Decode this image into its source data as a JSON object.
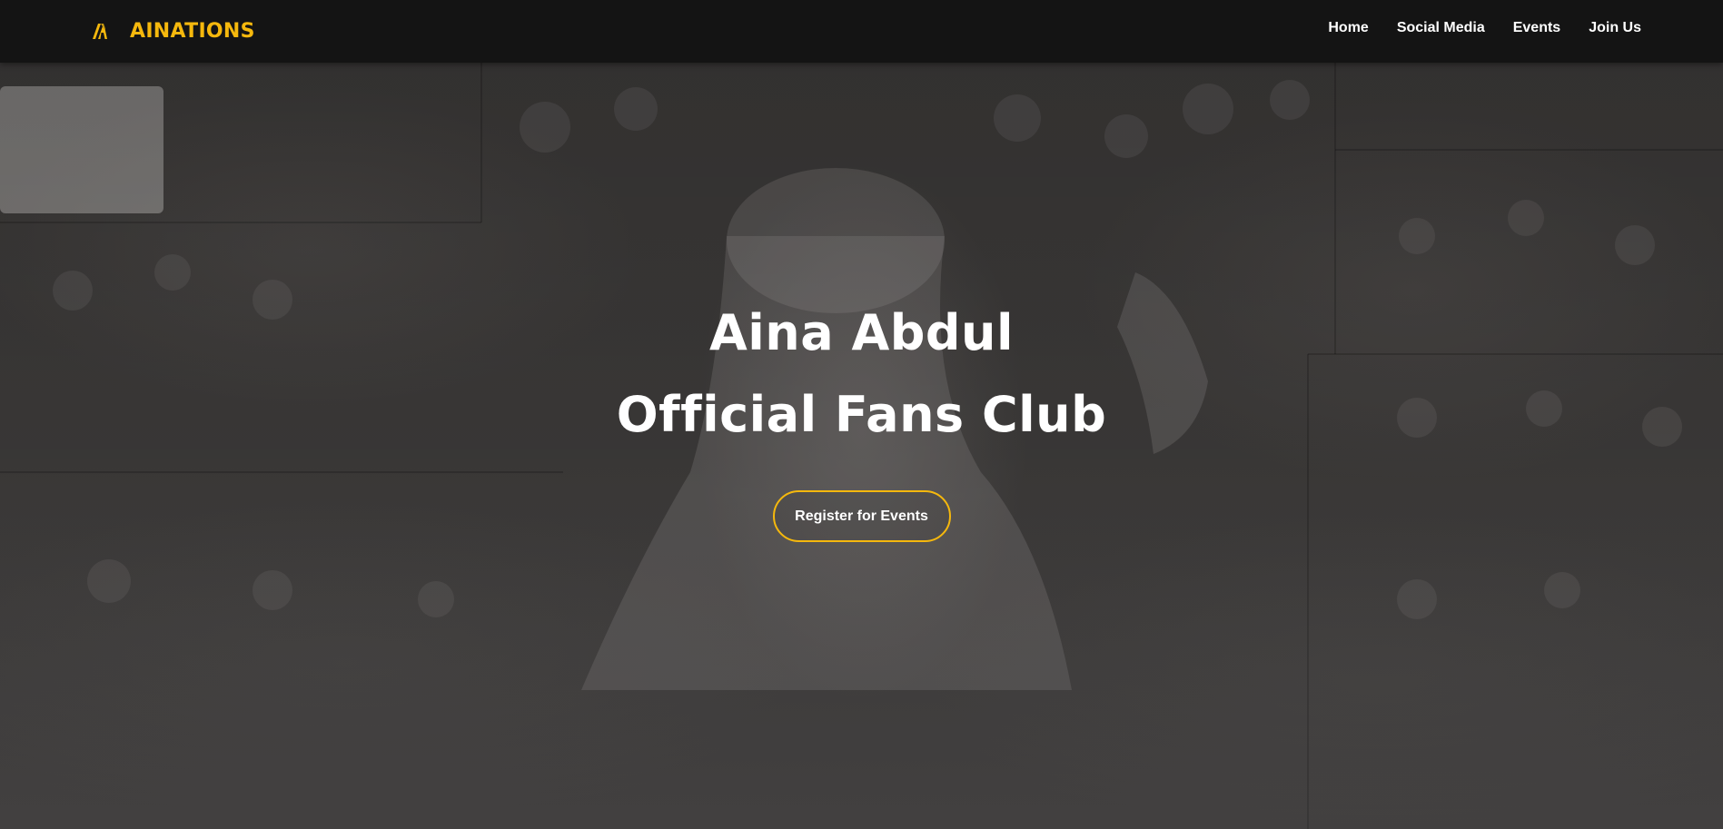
{
  "brand": {
    "name": "AINATIONS",
    "accent_color": "#f5b80d",
    "logo_icon": "ainations-logo-icon"
  },
  "nav": {
    "items": [
      {
        "label": "Home"
      },
      {
        "label": "Social Media"
      },
      {
        "label": "Events"
      },
      {
        "label": "Join Us"
      }
    ]
  },
  "hero": {
    "title_line1": "Aina Abdul",
    "title_line2": "Official Fans Club",
    "cta_label": "Register for Events",
    "cta_border_color": "#f5b80d",
    "background_image": "crowd-collage-background"
  }
}
